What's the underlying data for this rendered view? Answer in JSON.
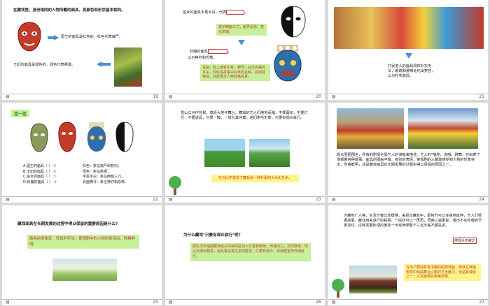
{
  "slides": [
    {
      "num": "19",
      "title": "在藏戏里，身份相同的人物所戴的面具，其颜色和形状基本相同。",
      "line1": "国王的面具是红色的，红色代表威严。",
      "line2": "王妃的面具是绿色的，绿色代表柔顺。"
    },
    {
      "num": "20",
      "line1a": "巫女的面具半黑半白，代表",
      "line1b": "。",
      "box1": "表示两面三刀，搬弄是非，变化多端。",
      "line2a": "妖魔的面具",
      "line2b": "，",
      "line3": "以示狰狞和恐怖。",
      "box2": "青面：助上或者牛筹；獠牙：凶杰内脑的本子。时时讲故事中好坏的这种。强调其特征。还能很本人物性格其意。"
    },
    {
      "num": "21",
      "caption": "村民老人的面具同样朴实无华，眼睛和黄带处纪出笑容，以示朴实敦厚。"
    },
    {
      "num": "22",
      "label": "连一连",
      "items": [
        "A.国王的面具（ ）",
        "B.王妃的面具（ ）",
        "C.巫女的面具（ ）",
        "D.妖魔的面具（ ）"
      ],
      "answers": [
        "②",
        "④",
        "①",
        "③"
      ],
      "meanings": [
        "红色：象征威严和权利；",
        "绿色：象征柔顺；",
        "半黑半白：象征两面三刀。",
        "青面獠牙：象征狰狞和恐怖。"
      ]
    },
    {
      "num": "23",
      "text": "雪山江河作背景，草原大地作舞台。藏戏的艺人们席地而唱，不要幕布，不要灯光，不要道具，只要一鼓、一钹为其伴奏。她们刚毛形象，只要有观众就行。",
      "banner": "在对比中发现了藏戏是一种朴素的大众化艺术。"
    },
    {
      "num": "24",
      "text": "观众围圈围坐，所有的剧情全靠艺人的演唱来描述。艺人的\"唱腔、说唱、跳舞，在由表了演绎着各种故事，面具的图画丰富、夸张的表情，使观剧的人都能感受到人物的形象突出，性格鲜明，这是藏戏面具在长期发展的过程中得以保留的原因之一。"
    },
    {
      "num": "25",
      "question": "藏戏面具在长期发展的过程中得以保留的重要原因是什么?",
      "answer": "面具运用象征、夸张的手法，使观剧中的人物形象突出，性格鲜明。"
    },
    {
      "num": "26",
      "question": "为什么藏戏\"只要有观众就行\"呢?",
      "answer": "唐东杰布组成藏戏班子的目的是功人行善和修桥，出钱出力，共同修桥，所以对演出要求，道具等没有过多的要求，只要有观众，戏就剧宣传作用就行。"
    },
    {
      "num": "27",
      "text": "为藏地广人稀，生活节奏比较缓慢，来观众藏戏中，即将节可以任意地延伸，艺人们根据故事，藏戏用来进行的叙事，一段戏可以一再再，再两三遍重复，唱出不在吃唱到节奏变化，这种发展处理的使其一出戏演绎整个三五天差不都是多。",
      "highlight": "使观众不疲乏",
      "box": "写出了藏戏具有浓郁的民族特色，使其在演唱表现中戏曲舞台以剧的艺术魅力，也是其成就之一，以及独特的审美效果。"
    }
  ],
  "colors": {
    "accent": "#4a90d9",
    "green": "#c6f09a",
    "yellow": "#fff48a",
    "red": "#c0392b"
  }
}
